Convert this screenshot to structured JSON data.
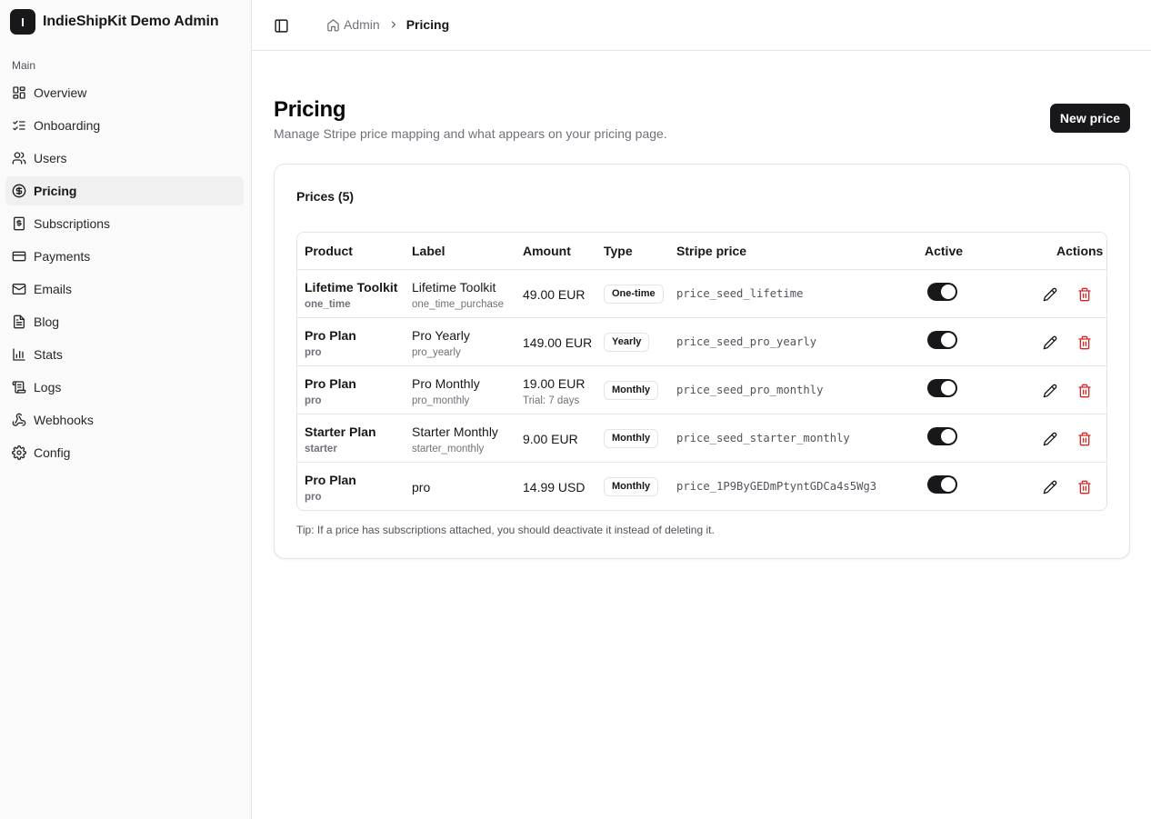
{
  "brand": {
    "logo_letter": "I",
    "name": "IndieShipKit Demo Admin"
  },
  "sidebar": {
    "group_label": "Main",
    "items": [
      {
        "label": "Overview",
        "icon": "layout-grid-icon"
      },
      {
        "label": "Onboarding",
        "icon": "list-checks-icon"
      },
      {
        "label": "Users",
        "icon": "users-icon"
      },
      {
        "label": "Pricing",
        "icon": "dollar-circle-icon",
        "active": true
      },
      {
        "label": "Subscriptions",
        "icon": "receipt-dollar-icon"
      },
      {
        "label": "Payments",
        "icon": "credit-card-icon"
      },
      {
        "label": "Emails",
        "icon": "mail-icon"
      },
      {
        "label": "Blog",
        "icon": "file-text-icon"
      },
      {
        "label": "Stats",
        "icon": "bar-chart-icon"
      },
      {
        "label": "Logs",
        "icon": "scroll-icon"
      },
      {
        "label": "Webhooks",
        "icon": "webhook-icon"
      },
      {
        "label": "Config",
        "icon": "settings-gear-icon"
      }
    ]
  },
  "breadcrumb": {
    "root": "Admin",
    "current": "Pricing"
  },
  "page": {
    "title": "Pricing",
    "subtitle": "Manage Stripe price mapping and what appears on your pricing page.",
    "new_button": "New price"
  },
  "card": {
    "title": "Prices (5)",
    "tip": "Tip: If a price has subscriptions attached, you should deactivate it instead of deleting it."
  },
  "table": {
    "headers": {
      "product": "Product",
      "label": "Label",
      "amount": "Amount",
      "type": "Type",
      "stripe": "Stripe price",
      "active": "Active",
      "actions": "Actions"
    },
    "rows": [
      {
        "product": "Lifetime Toolkit",
        "product_key": "one_time",
        "label": "Lifetime Toolkit",
        "label_key": "one_time_purchase",
        "amount": "49.00 EUR",
        "amount_sub": "",
        "type": "One-time",
        "stripe": "price_seed_lifetime",
        "active": true
      },
      {
        "product": "Pro Plan",
        "product_key": "pro",
        "label": "Pro Yearly",
        "label_key": "pro_yearly",
        "amount": "149.00 EUR",
        "amount_sub": "",
        "type": "Yearly",
        "stripe": "price_seed_pro_yearly",
        "active": true
      },
      {
        "product": "Pro Plan",
        "product_key": "pro",
        "label": "Pro Monthly",
        "label_key": "pro_monthly",
        "amount": "19.00 EUR",
        "amount_sub": "Trial: 7 days",
        "type": "Monthly",
        "stripe": "price_seed_pro_monthly",
        "active": true
      },
      {
        "product": "Starter Plan",
        "product_key": "starter",
        "label": "Starter Monthly",
        "label_key": "starter_monthly",
        "amount": "9.00 EUR",
        "amount_sub": "",
        "type": "Monthly",
        "stripe": "price_seed_starter_monthly",
        "active": true
      },
      {
        "product": "Pro Plan",
        "product_key": "pro",
        "label": "pro",
        "label_key": "",
        "amount": "14.99 USD",
        "amount_sub": "",
        "type": "Monthly",
        "stripe": "price_1P9ByGEDmPtyntGDCa4s5Wg3",
        "active": true
      }
    ]
  },
  "colors": {
    "primary": "#18181b",
    "danger": "#dc2626",
    "muted": "#71717a",
    "border": "#e4e4e7",
    "sidebar_bg": "#fafafa"
  }
}
